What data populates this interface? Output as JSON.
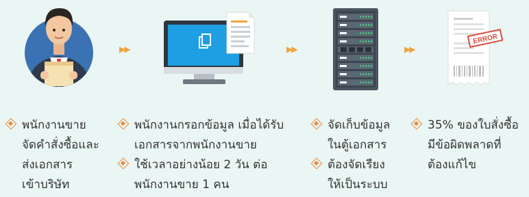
{
  "steps": [
    {
      "icon": "businessman-holding-documents-icon",
      "items": [
        {
          "lines": [
            "พนักงานขาย",
            "จัดคำสั่งซื้อและ",
            "ส่งเอกสาร",
            "เข้าบริษัท"
          ]
        }
      ]
    },
    {
      "icon": "computer-monitor-document-icon",
      "items": [
        {
          "lines": [
            "พนักงานกรอกข้อมูล เมื่อได้รับ",
            "เอกสารจากพนักงานขาย"
          ]
        },
        {
          "lines": [
            "ใช้เวลาอย่างน้อย 2 วัน ต่อ",
            "พนักงานขาย 1 คน"
          ]
        }
      ]
    },
    {
      "icon": "server-rack-icon",
      "items": [
        {
          "lines": [
            "จัดเก็บข้อมูล",
            "ในตู้เอกสาร"
          ]
        },
        {
          "lines": [
            "ต้องจัดเรียง",
            "ให้เป็นระบบ"
          ]
        }
      ]
    },
    {
      "icon": "receipt-error-stamp-icon",
      "stamp_text": "ERROR",
      "items": [
        {
          "lines": [
            "35% ของใบสั่งซื้อ",
            "มีข้อผิดพลาดที่",
            "ต้องแก้ไข"
          ]
        }
      ]
    }
  ],
  "arrows": [
    "▶▶",
    "▶▶",
    "▶▶"
  ],
  "colors": {
    "background": "#eaf6f4",
    "accent_orange": "#f5a13c",
    "bullet": "#e98a3a",
    "avatar_circle": "#3a72b3",
    "monitor_screen": "#1e9fe3",
    "server_body": "#4a5560",
    "server_led": "#3ddc84",
    "error_red": "#e0483a"
  }
}
